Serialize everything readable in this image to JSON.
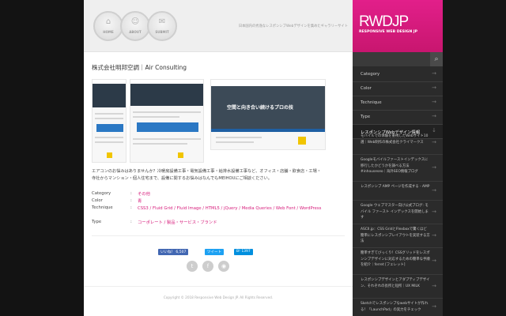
{
  "header": {
    "nav": [
      {
        "glyph": "⌂",
        "label": "HOME"
      },
      {
        "glyph": "☺",
        "label": "ABOUT"
      },
      {
        "glyph": "✉",
        "label": "SUBMIT"
      }
    ],
    "tagline": "日本国内の秀逸なレスポンシブWebデザインを集めたギャラリーサイト"
  },
  "site": {
    "title": "株式会社明邦空調｜Air Consulting",
    "description": "エアコンのお悩みはありませんか？冷暖房設備工事・電気設備工事・給排水設備工事など、オフィス・店舗・飲食店・工場・寺社からマンション・個人住宅まで、設備に関するお悩みはなんでもMEIHOUにご相談ください。",
    "hero_text": "空間と向き合い続けるプロの技",
    "meta": [
      {
        "key": "Category",
        "value": "その他"
      },
      {
        "key": "Color",
        "value": "青"
      },
      {
        "key": "Technique",
        "value": "CSS3 / Fluid Grid / Fluid Image / HTML5 / jQuery / Media Queries / Web Font / WordPress"
      },
      {
        "key": "Type",
        "value": "コーポレート / 製品・サービス・ブランド"
      }
    ]
  },
  "social": {
    "like": "いいね！ 6,507",
    "tweet": "ツイート",
    "hatena": "B! 1397"
  },
  "footer": {
    "copyright": "Copyright © 2018 Responsive Web Design JP. All Rights Reserved."
  },
  "sidebar": {
    "logo_big": "RWDJP",
    "logo_small": "RESPONSIVE WEB DESIGN JP",
    "menu": [
      "Category",
      "Color",
      "Technique",
      "Type",
      "レスポンシブWebデザイン情報"
    ],
    "posts": [
      "モバイルでの体験を重視したWebサイト10選｜Web制作の株式会社クライマークス",
      "Googleモバイルファーストインデックスに移行したかどうかを調べる方法 #inhouseseo｜海外SEO情報ブログ",
      "レスポンシブ AMP ページを作成する - AMP",
      "Google ウェブマスター向け公式ブログ: モバイル ファースト インデックスを開始します",
      "ASCII.jp：CSS GridとFlexboxで驚くほど簡単にレスポンシブレイアウトを実装する方法",
      "簡単すぎてびっくり！CSSグリッドをレスポンシブデザインに対応するための簡単な手順を紹介｜ferret [フェレット]",
      "レスポンシブデザインとアダプティブデザイン、それぞれの長所と短所｜UX MILK",
      "Sketchでレスポンシブなwebサイトが作れる！「LaunchPad」の実力をチェック"
    ]
  }
}
